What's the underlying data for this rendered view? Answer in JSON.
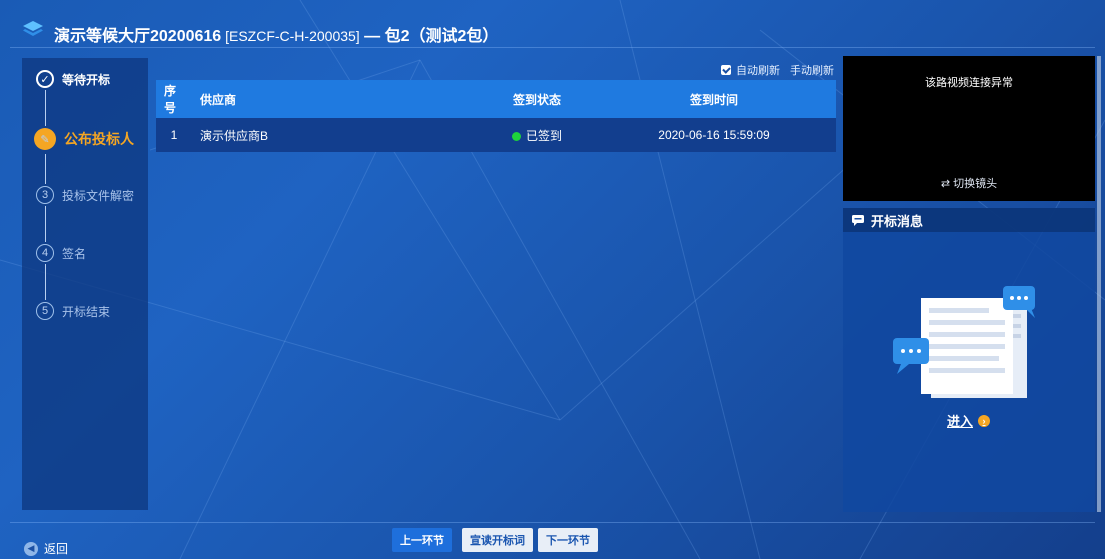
{
  "header": {
    "title_main": "演示等候大厅20200616",
    "title_code": " [ESZCF-C-H-200035]",
    "title_sep": " — ",
    "title_pkg": "包2（测试2包）"
  },
  "steps": [
    {
      "num": "✓",
      "label": "等待开标",
      "state": "done"
    },
    {
      "num": "✎",
      "label": "公布投标人",
      "state": "active"
    },
    {
      "num": "3",
      "label": "投标文件解密",
      "state": "pending"
    },
    {
      "num": "4",
      "label": "签名",
      "state": "pending"
    },
    {
      "num": "5",
      "label": "开标结束",
      "state": "pending"
    }
  ],
  "refresh": {
    "auto_label": "自动刷新",
    "manual_label": "手动刷新"
  },
  "table": {
    "headers": [
      "序号",
      "供应商",
      "签到状态",
      "签到时间"
    ],
    "rows": [
      {
        "index": "1",
        "supplier": "演示供应商B",
        "status": "已签到",
        "time": "2020-06-16 15:59:09"
      }
    ]
  },
  "video": {
    "error_text": "该路视频连接异常",
    "switch_label": "⇄  切换镜头"
  },
  "messages": {
    "title": "开标消息",
    "enter_label": "进入"
  },
  "footer": {
    "back_label": "返回",
    "prev_label": "上一环节",
    "read_label": "宣读开标词",
    "next_label": "下一环节"
  },
  "colors": {
    "accent": "#f5a623",
    "primary_button": "#1e6fdc",
    "table_header": "#1f7ae0",
    "status_signed": "#1ed33b"
  }
}
